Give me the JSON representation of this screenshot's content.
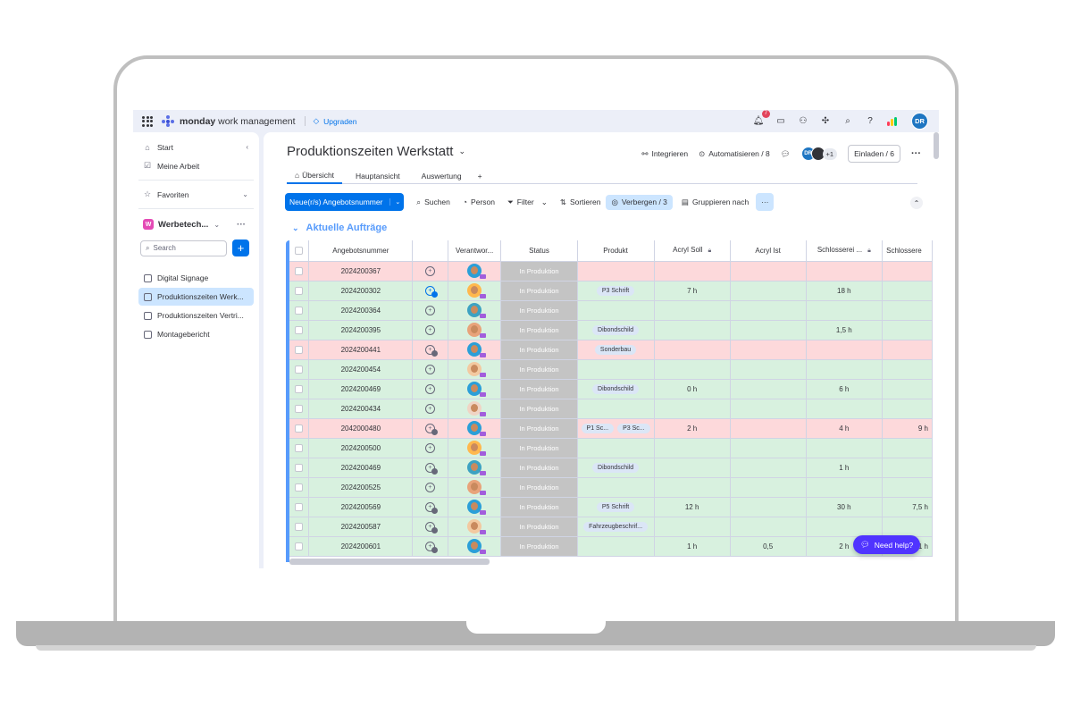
{
  "topbar": {
    "brand_bold": "monday",
    "brand_rest": " work management",
    "upgrade_label": "Upgraden",
    "notification_count": "7",
    "user_initials": "DR"
  },
  "sidebar": {
    "items": [
      {
        "label": "Start"
      },
      {
        "label": "Meine Arbeit"
      }
    ],
    "favorites_label": "Favoriten",
    "workspace_badge": "W",
    "workspace_name": "Werbetech...",
    "search_placeholder": "Search",
    "boards": [
      {
        "label": "Digital Signage"
      },
      {
        "label": "Produktionszeiten Werk..."
      },
      {
        "label": "Produktionszeiten Vertri..."
      },
      {
        "label": "Montagebericht"
      }
    ]
  },
  "board": {
    "title": "Produktionszeiten Werkstatt",
    "integrate_label": "Integrieren",
    "automate_label": "Automatisieren / 8",
    "stack_initials": "DR",
    "plus_count": "+1",
    "invite_label": "Einladen / 6",
    "tabs": [
      {
        "label": "Übersicht"
      },
      {
        "label": "Hauptansicht"
      },
      {
        "label": "Auswertung"
      },
      {
        "label": "+"
      }
    ]
  },
  "toolbar": {
    "new_label": "Neue(r/s) Angebotsnummer",
    "search_label": "Suchen",
    "person_label": "Person",
    "filter_label": "Filter",
    "sort_label": "Sortieren",
    "hide_label": "Verbergen / 3",
    "group_label": "Gruppieren nach",
    "more_label": "···"
  },
  "group": {
    "title": "Aktuelle Aufträge",
    "color": "#579bfc"
  },
  "table": {
    "columns": [
      "Angebotsnummer",
      "Verantwor...",
      "Status",
      "Produkt",
      "Acryl Soll",
      "Acryl Ist",
      "Schlosserei ...",
      "Schlossere"
    ],
    "rows": [
      {
        "id": "2024200367",
        "color": "red",
        "status": "In Produktion",
        "products": [],
        "acryl_soll": "",
        "acryl_ist": "",
        "schlosserei": "",
        "schlossere": ""
      },
      {
        "id": "2024200302",
        "color": "green",
        "status": "In Produktion",
        "products": [
          "P3 Schrift"
        ],
        "acryl_soll": "7 h",
        "acryl_ist": "",
        "schlosserei": "18 h",
        "schlossere": ""
      },
      {
        "id": "2024200364",
        "color": "green",
        "status": "In Produktion",
        "products": [],
        "acryl_soll": "",
        "acryl_ist": "",
        "schlosserei": "",
        "schlossere": ""
      },
      {
        "id": "2024200395",
        "color": "green",
        "status": "In Produktion",
        "products": [
          "Dibondschild"
        ],
        "acryl_soll": "",
        "acryl_ist": "",
        "schlosserei": "1,5 h",
        "schlossere": ""
      },
      {
        "id": "2024200441",
        "color": "red",
        "status": "In Produktion",
        "products": [
          "Sonderbau"
        ],
        "acryl_soll": "",
        "acryl_ist": "",
        "schlosserei": "",
        "schlossere": ""
      },
      {
        "id": "2024200454",
        "color": "green",
        "status": "In Produktion",
        "products": [],
        "acryl_soll": "",
        "acryl_ist": "",
        "schlosserei": "",
        "schlossere": ""
      },
      {
        "id": "2024200469",
        "color": "green",
        "status": "In Produktion",
        "products": [
          "Dibondschild"
        ],
        "acryl_soll": "0 h",
        "acryl_ist": "",
        "schlosserei": "6 h",
        "schlossere": ""
      },
      {
        "id": "2024200434",
        "color": "green",
        "status": "In Produktion",
        "products": [],
        "acryl_soll": "",
        "acryl_ist": "",
        "schlosserei": "",
        "schlossere": ""
      },
      {
        "id": "2042000480",
        "color": "red",
        "status": "In Produktion",
        "products": [
          "P1 Sc...",
          "P3 Sc..."
        ],
        "acryl_soll": "2 h",
        "acryl_ist": "",
        "schlosserei": "4 h",
        "schlossere": "9 h"
      },
      {
        "id": "2024200500",
        "color": "green",
        "status": "In Produktion",
        "products": [],
        "acryl_soll": "",
        "acryl_ist": "",
        "schlosserei": "",
        "schlossere": ""
      },
      {
        "id": "2024200469",
        "color": "green",
        "status": "In Produktion",
        "products": [
          "Dibondschild"
        ],
        "acryl_soll": "",
        "acryl_ist": "",
        "schlosserei": "1 h",
        "schlossere": ""
      },
      {
        "id": "2024200525",
        "color": "green",
        "status": "In Produktion",
        "products": [],
        "acryl_soll": "",
        "acryl_ist": "",
        "schlosserei": "",
        "schlossere": ""
      },
      {
        "id": "2024200569",
        "color": "green",
        "status": "In Produktion",
        "products": [
          "P5 Schrift"
        ],
        "acryl_soll": "12 h",
        "acryl_ist": "",
        "schlosserei": "30 h",
        "schlossere": "7,5 h"
      },
      {
        "id": "2024200587",
        "color": "green",
        "status": "In Produktion",
        "products": [
          "Fahrzeugbeschrif..."
        ],
        "acryl_soll": "",
        "acryl_ist": "",
        "schlosserei": "",
        "schlossere": ""
      },
      {
        "id": "2024200601",
        "color": "green",
        "status": "In Produktion",
        "products": [],
        "acryl_soll": "1 h",
        "acryl_ist": "0,5",
        "schlosserei": "2 h",
        "schlossere": "1 h"
      }
    ]
  },
  "help_label": "Need help?"
}
